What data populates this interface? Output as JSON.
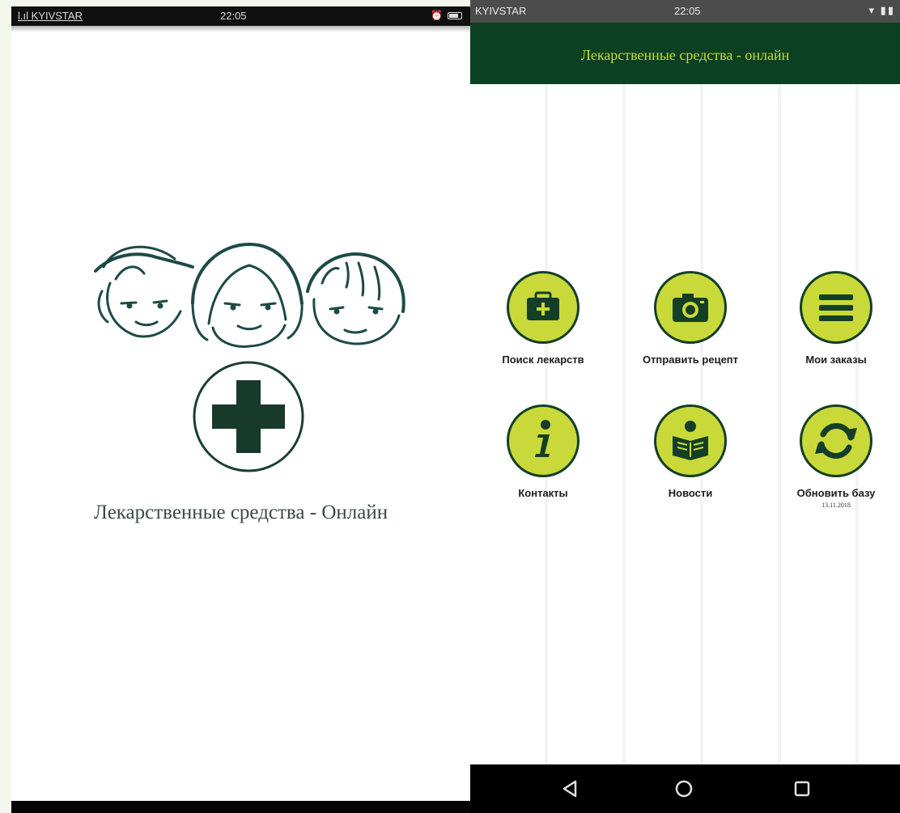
{
  "left_screen": {
    "status": {
      "carrier": "l.ıl KYIVSTAR",
      "time": "22:05"
    },
    "splash_title": "Лекарственные средства - Онлайн"
  },
  "right_screen": {
    "status": {
      "carrier": "KYIVSTAR",
      "time": "22:05"
    },
    "header": {
      "title": "Лекарственные средства - онлайн",
      "bg_color": "#0b4023",
      "title_color": "#c6dc3a"
    },
    "menu": [
      {
        "label": "Поиск лекарств",
        "icon": "first-aid-kit-icon"
      },
      {
        "label": "Отправить рецепт",
        "icon": "camera-icon"
      },
      {
        "label": "Мои заказы",
        "icon": "menu-list-icon"
      },
      {
        "label": "Контакты",
        "icon": "info-icon"
      },
      {
        "label": "Новости",
        "icon": "news-reader-icon"
      },
      {
        "label": "Обновить базу",
        "icon": "refresh-icon",
        "date": "13.11.2018"
      }
    ],
    "accent_color": "#c9d93a",
    "nav": [
      "back-icon",
      "home-icon",
      "recents-icon"
    ]
  }
}
